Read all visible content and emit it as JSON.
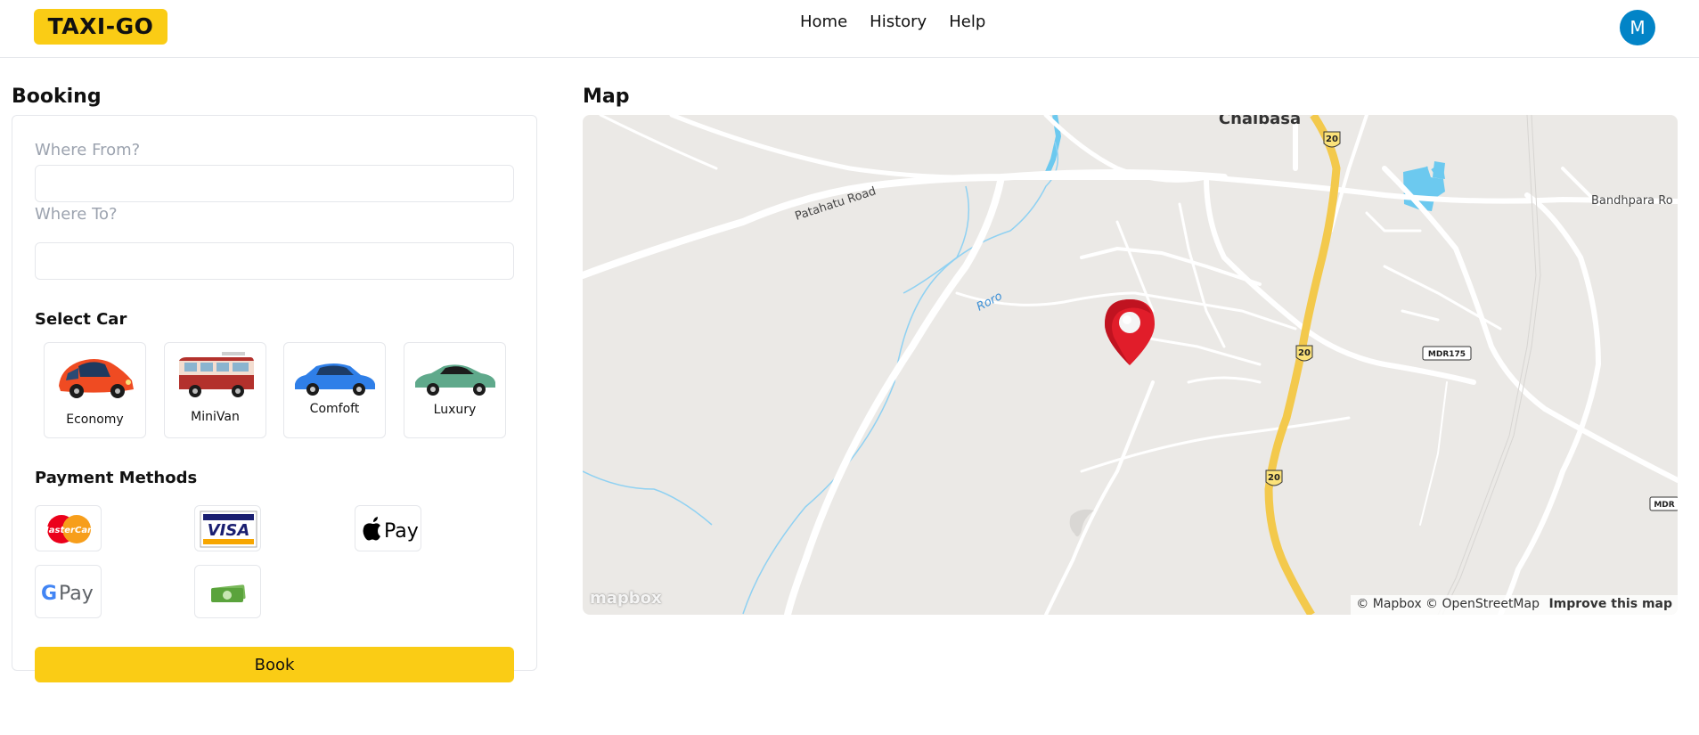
{
  "app": {
    "logo_text": "TAXI-GO"
  },
  "nav": {
    "items": [
      "Home",
      "History",
      "Help"
    ]
  },
  "user": {
    "avatar_initial": "M"
  },
  "booking": {
    "title": "Booking",
    "from_label": "Where From?",
    "from_value": "",
    "to_label": "Where To?",
    "to_value": "",
    "select_car_label": "Select Car",
    "cars": [
      {
        "label": "Economy",
        "color": "#ef4b22",
        "icon": "economy-car-icon"
      },
      {
        "label": "MiniVan",
        "color": "#b3312c",
        "icon": "minivan-icon"
      },
      {
        "label": "Comfoft",
        "color": "#2f7fe8",
        "icon": "comfort-car-icon"
      },
      {
        "label": "Luxury",
        "color": "#5fa98b",
        "icon": "luxury-car-icon"
      }
    ],
    "payment_label": "Payment Methods",
    "payments": [
      {
        "name": "MasterCard",
        "icon": "mastercard-icon"
      },
      {
        "name": "VISA",
        "icon": "visa-icon"
      },
      {
        "name": "Pay",
        "icon": "apple-pay-icon"
      },
      {
        "name": "Pay",
        "icon": "google-pay-icon"
      },
      {
        "name": "Cash",
        "icon": "cash-icon"
      }
    ],
    "book_label": "Book"
  },
  "map": {
    "title": "Map",
    "labels": {
      "city": "Chaibasa",
      "road1": "Patahatu Road",
      "river": "Roro",
      "road2": "Bandhpara Ro",
      "shield_20": "20",
      "mdr175": "MDR175",
      "mdr": "MDR"
    },
    "logo_text": "mapbox",
    "attribution": "© Mapbox © OpenStreetMap",
    "improve": "Improve this map"
  },
  "colors": {
    "accent": "#facc15",
    "avatar": "#0284c7",
    "pin": "#e11d2a",
    "highway": "#f3c94c",
    "water": "#6cc9ef"
  }
}
